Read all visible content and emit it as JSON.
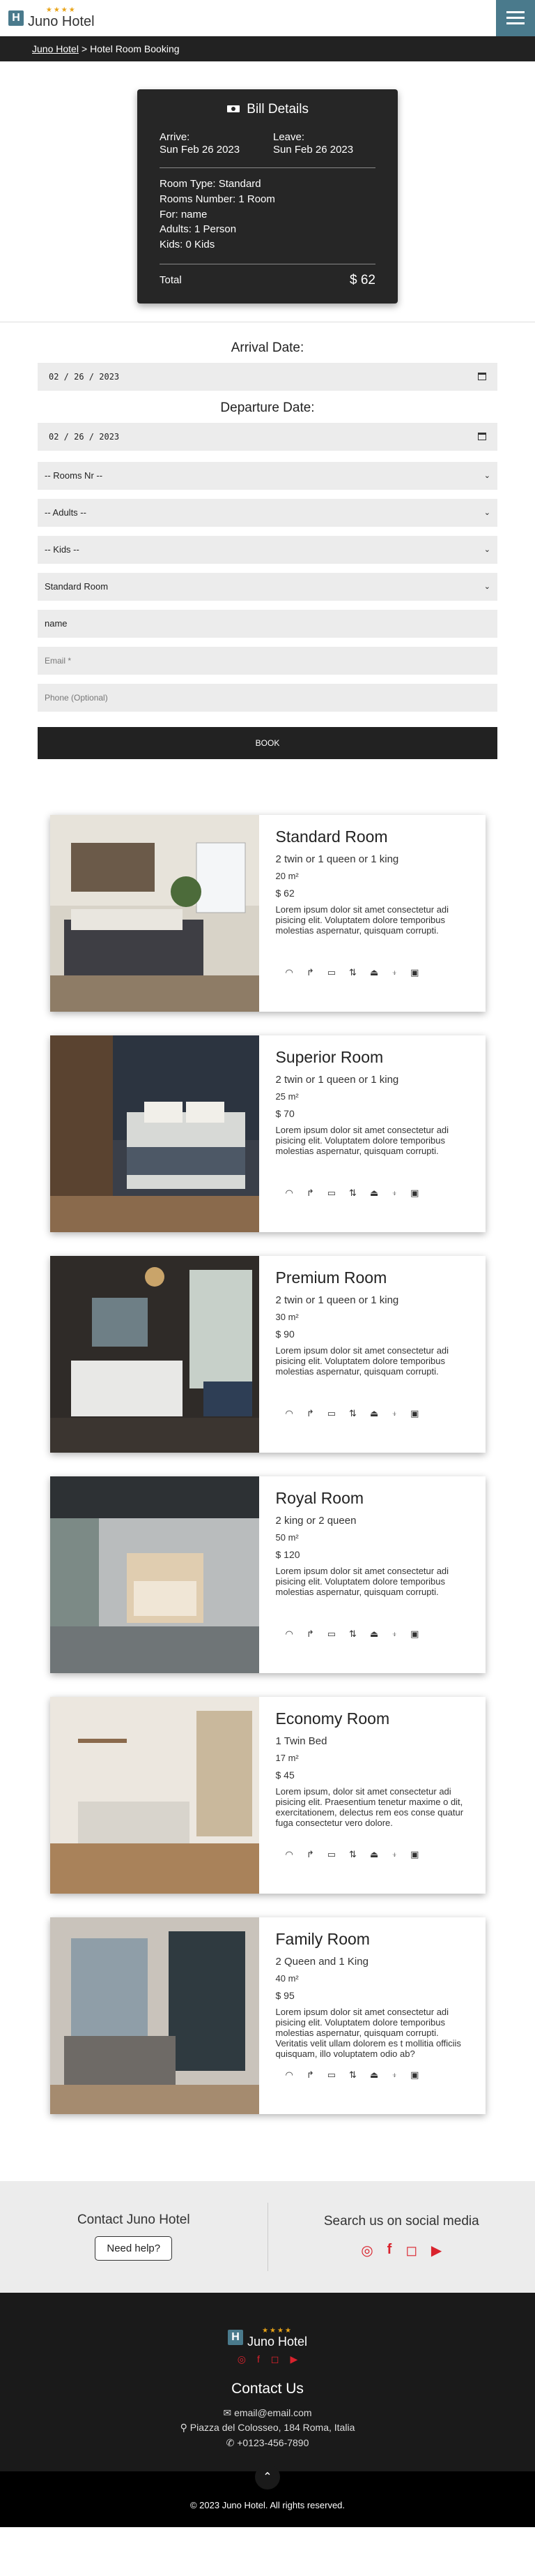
{
  "header": {
    "logo_letter": "H",
    "stars": "★★★★",
    "brand": "Juno Hotel"
  },
  "breadcrumb": {
    "home": "Juno Hotel",
    "separator": ">",
    "current": "Hotel Room Booking"
  },
  "bill": {
    "title": "Bill Details",
    "arrive_label": "Arrive:",
    "arrive_value": "Sun Feb 26 2023",
    "leave_label": "Leave:",
    "leave_value": "Sun Feb 26 2023",
    "room_type": "Room Type:  Standard",
    "rooms_number": "Rooms Number:  1 Room",
    "for": "For:  name",
    "adults": "Adults:  1 Person",
    "kids": "Kids:  0 Kids",
    "total_label": "Total",
    "total_value": "$ 62"
  },
  "form": {
    "arrival_label": "Arrival Date:",
    "arrival_value": "02 / 26 / 2023",
    "departure_label": "Departure Date:",
    "departure_value": "02 / 26 / 2023",
    "rooms_select": "-- Rooms Nr --",
    "adults_select": "-- Adults --",
    "kids_select": "-- Kids --",
    "roomtype_select": "Standard Room",
    "name_value": "name",
    "email_placeholder": "Email *",
    "phone_placeholder": "Phone (Optional)",
    "book_label": "BOOK"
  },
  "amenity_icons": [
    "wifi-icon",
    "shower-icon",
    "tv-icon",
    "elevator-icon",
    "iron-icon",
    "sink-icon",
    "safe-icon"
  ],
  "rooms": [
    {
      "name": "Standard Room",
      "beds": "2 twin or 1 queen or 1 king",
      "size": "20 m²",
      "price": "$ 62",
      "desc": "Lorem ipsum dolor sit amet consectetur adi pisicing elit. Voluptatem dolore temporibus molestias aspernatur, quisquam corrupti."
    },
    {
      "name": "Superior Room",
      "beds": "2 twin or 1 queen or 1 king",
      "size": "25 m²",
      "price": "$ 70",
      "desc": "Lorem ipsum dolor sit amet consectetur adi pisicing elit. Voluptatem dolore temporibus molestias aspernatur, quisquam corrupti."
    },
    {
      "name": "Premium Room",
      "beds": "2 twin or 1 queen or 1 king",
      "size": "30 m²",
      "price": "$ 90",
      "desc": "Lorem ipsum dolor sit amet consectetur adi pisicing elit. Voluptatem dolore temporibus molestias aspernatur, quisquam corrupti."
    },
    {
      "name": "Royal Room",
      "beds": "2 king or 2 queen",
      "size": "50 m²",
      "price": "$ 120",
      "desc": "Lorem ipsum dolor sit amet consectetur adi pisicing elit. Voluptatem dolore temporibus molestias aspernatur, quisquam corrupti."
    },
    {
      "name": "Economy Room",
      "beds": "1 Twin Bed",
      "size": "17 m²",
      "price": "$ 45",
      "desc": "Lorem ipsum, dolor sit amet consectetur adi pisicing elit. Praesentium tenetur maxime o dit, exercitationem, delectus rem eos conse quatur fuga consectetur vero dolore."
    },
    {
      "name": "Family Room",
      "beds": "2 Queen and 1 King",
      "size": "40 m²",
      "price": "$ 95",
      "desc": "Lorem ipsum dolor sit amet consectetur adi pisicing elit. Voluptatem dolore temporibus molestias aspernatur, quisquam corrupti. Veritatis velit ullam dolorem es t mollitia officiis quisquam, illo voluptatem odio ab?"
    }
  ],
  "contact": {
    "title": "Contact Juno Hotel",
    "help_button": "Need help?",
    "social_title": "Search us on social media"
  },
  "footer": {
    "contact_title": "Contact Us",
    "email": "email@email.com",
    "address": "Piazza del Colosseo, 184 Roma, Italia",
    "phone": "+0123-456-7890",
    "copyright": "© 2023 Juno Hotel. All rights reserved."
  },
  "colors": {
    "brand": "#4a7a8c",
    "accent_red": "#d9232d",
    "star": "#e8a317",
    "dark": "#222222"
  }
}
